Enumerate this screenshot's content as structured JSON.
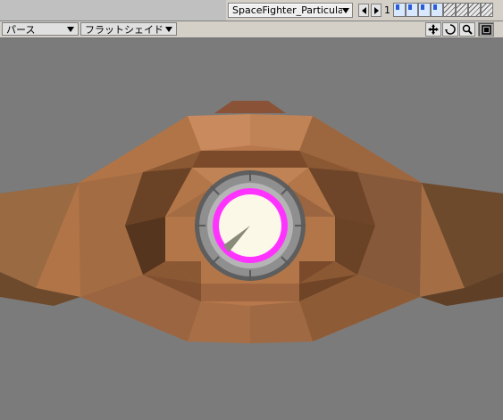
{
  "toolbar": {
    "object_name": "SpaceFighter_Particular",
    "frame_number": "1",
    "layer_slots": [
      "on",
      "on",
      "on",
      "on",
      "stripe",
      "stripe",
      "stripe",
      "stripe",
      "stripe",
      "stripe"
    ]
  },
  "viewport": {
    "projection_label": "パース",
    "shading_label": "フラットシェイド",
    "tools": [
      "move-view-icon",
      "rotate-view-icon",
      "zoom-view-icon",
      "maximize-view-icon"
    ]
  },
  "colors": {
    "background": "#7b7b7b",
    "hull_light": "#c4875d",
    "hull_dark": "#6a4628",
    "emissive_ring": "#ff33ff",
    "core": "#fbf8e8"
  }
}
